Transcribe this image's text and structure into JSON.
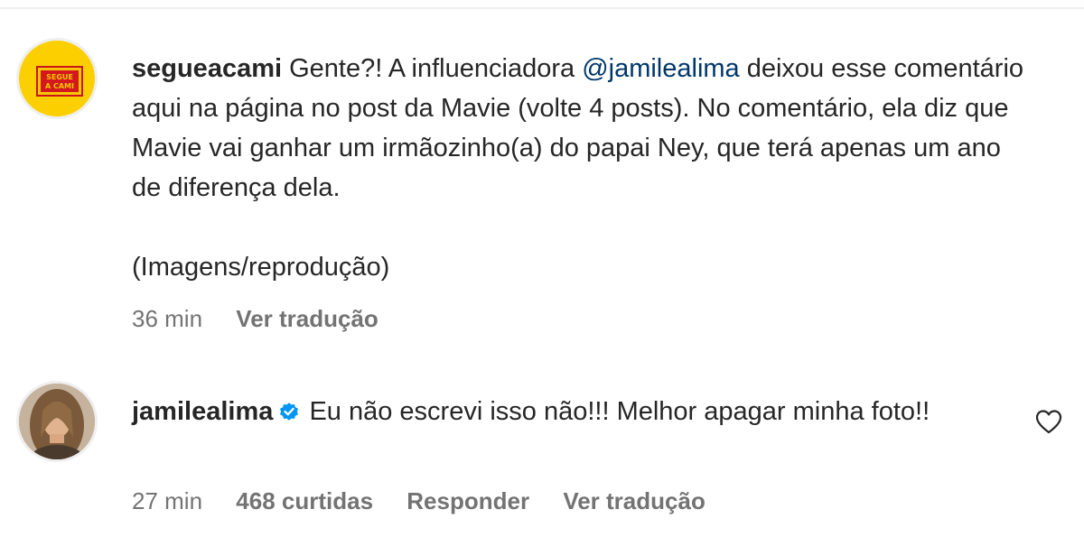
{
  "comments": [
    {
      "username": "segueacami",
      "avatar_text": "SEGUE A CAMI",
      "text_before_mention": "Gente?! A influenciadora ",
      "mention": "@jamilealima",
      "text_after_mention": " deixou esse comentário aqui na página no post da Mavie (volte 4 posts). No comentário, ela diz que Mavie vai ganhar um irmãozinho(a) do papai Ney, que terá apenas um ano de diferença dela.",
      "second_paragraph": "(Imagens/reprodução)",
      "time": "36 min",
      "translate_label": "Ver tradução"
    },
    {
      "username": "jamilealima",
      "verified": true,
      "text": "Eu não escrevi isso não!!! Melhor apagar minha foto!!",
      "time": "27 min",
      "likes": "468 curtidas",
      "reply_label": "Responder",
      "translate_label": "Ver tradução",
      "like_icon": "heart-outline-icon"
    }
  ],
  "colors": {
    "mention": "#00376b",
    "verified_badge": "#0095f6",
    "meta_text": "#737373",
    "avatar_yellow": "#fcd000",
    "avatar_red": "#d3191e"
  }
}
